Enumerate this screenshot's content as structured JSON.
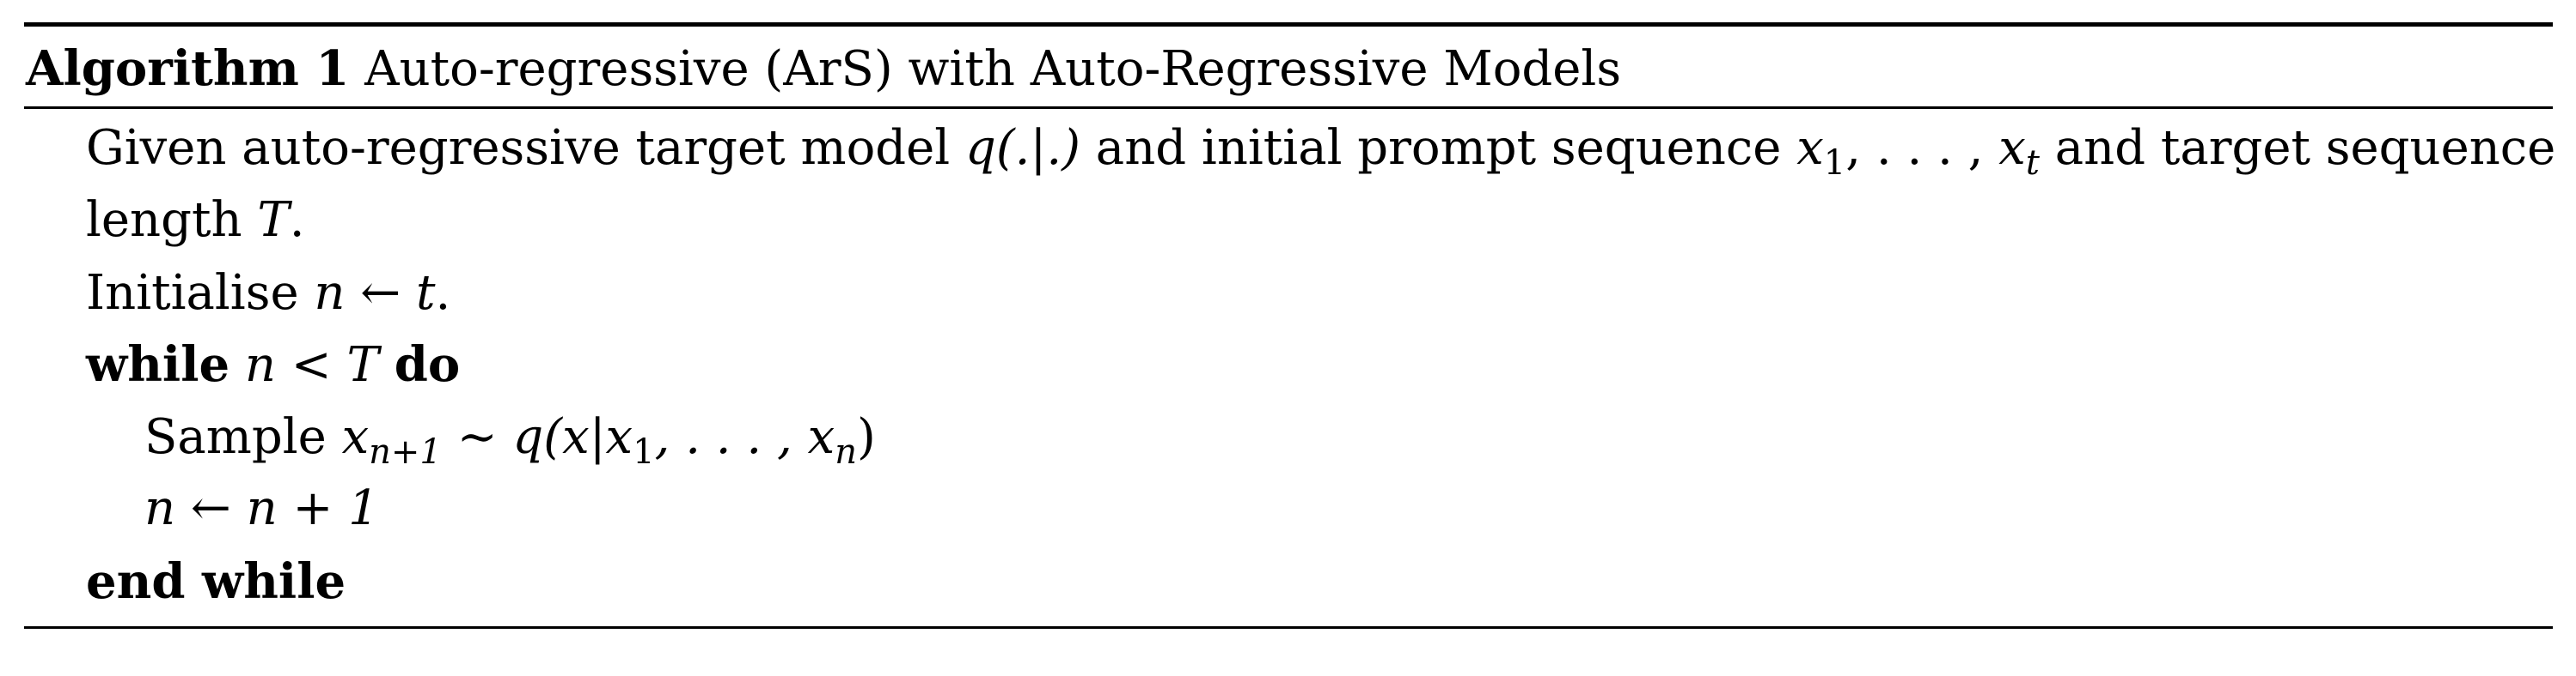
{
  "algorithm": {
    "label": "Algorithm 1",
    "title": "Auto-regressive (ArS) with Auto-Regressive Models"
  },
  "lines": {
    "l1": {
      "text_a": "Given auto-regressive target model ",
      "math_a": "q(.|.)",
      "text_b": " and initial prompt sequence ",
      "math_b1": "x",
      "math_b1_sub": "1",
      "math_b_mid": ", . . . , ",
      "math_b2": "x",
      "math_b2_sub": "t",
      "text_c": " and target sequence"
    },
    "l2": {
      "text_a": "length ",
      "math_a": "T",
      "text_b": "."
    },
    "l3": {
      "text_a": "Initialise ",
      "math_a": "n ← t",
      "text_b": "."
    },
    "l4": {
      "kw_a": "while",
      "math_a": "n < T",
      "kw_b": "do"
    },
    "l5": {
      "text_a": "Sample ",
      "math_a": "x",
      "math_a_sub": "n+1",
      "math_b": " ∼ q(x|x",
      "math_b_sub": "1",
      "math_c": ", . . . , x",
      "math_c_sub": "n",
      "math_d": ")"
    },
    "l6": {
      "math_a": "n ← n + 1"
    },
    "l7": {
      "kw_a": "end while"
    }
  }
}
